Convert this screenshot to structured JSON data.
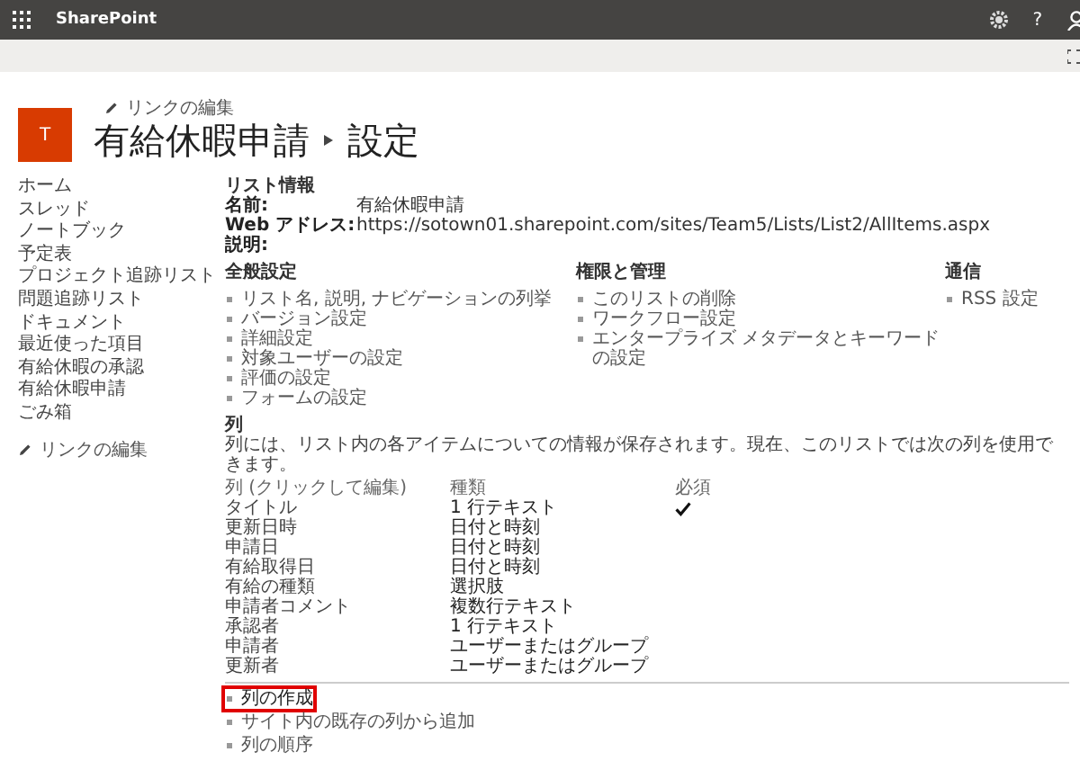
{
  "top_bar": {
    "app_name": "SharePoint",
    "help": "?"
  },
  "header": {
    "logo_letter": "T",
    "edit_links": "リンクの編集",
    "title": "有給休暇申請",
    "page": "設定"
  },
  "nav": {
    "items": [
      "ホーム",
      "スレッド",
      "ノートブック",
      "予定表",
      "プロジェクト追跡リスト",
      "問題追跡リスト",
      "ドキュメント",
      "最近使った項目",
      "有給休暇の承認",
      "有給休暇申請",
      "ごみ箱"
    ],
    "edit_links": "リンクの編集"
  },
  "list_info": {
    "heading": "リスト情報",
    "fields": [
      {
        "label": "名前:",
        "value": "有給休暇申請"
      },
      {
        "label": "Web アドレス:",
        "value": "https://sotown01.sharepoint.com/sites/Team5/Lists/List2/AllItems.aspx"
      },
      {
        "label": "説明:"
      }
    ]
  },
  "sections": [
    {
      "heading": "全般設定",
      "links": [
        "リスト名, 説明, ナビゲーションの列挙",
        "バージョン設定",
        "詳細設定",
        "対象ユーザーの設定",
        "評価の設定",
        "フォームの設定"
      ]
    },
    {
      "heading": "権限と管理",
      "links": [
        "このリストの削除",
        "ワークフロー設定",
        "エンタープライズ メタデータとキーワードの設定"
      ]
    },
    {
      "heading": "通信",
      "links": [
        "RSS 設定"
      ]
    }
  ],
  "columns": {
    "heading": "列",
    "description": "列には、リスト内の各アイテムについての情報が保存されます。現在、このリストでは次の列を使用できます。",
    "table": {
      "columns": [
        "列 (クリックして編集)",
        "種類",
        "必須"
      ],
      "rows": [
        {
          "name": "タイトル",
          "type": "1 行テキスト",
          "required": true
        },
        {
          "name": "更新日時",
          "type": "日付と時刻",
          "required": false
        },
        {
          "name": "申請日",
          "type": "日付と時刻",
          "required": false
        },
        {
          "name": "有給取得日",
          "type": "日付と時刻",
          "required": false
        },
        {
          "name": "有給の種類",
          "type": "選択肢",
          "required": false
        },
        {
          "name": "申請者コメント",
          "type": "複数行テキスト",
          "required": false
        },
        {
          "name": "承認者",
          "type": "1 行テキスト",
          "required": false
        },
        {
          "name": "申請者",
          "type": "ユーザーまたはグループ",
          "required": false
        },
        {
          "name": "更新者",
          "type": "ユーザーまたはグループ",
          "required": false
        }
      ]
    },
    "actions": [
      {
        "label": "列の作成",
        "highlighted": true
      },
      {
        "label": "サイト内の既存の列から追加",
        "highlighted": false
      },
      {
        "label": "列の順序",
        "highlighted": false
      }
    ]
  }
}
